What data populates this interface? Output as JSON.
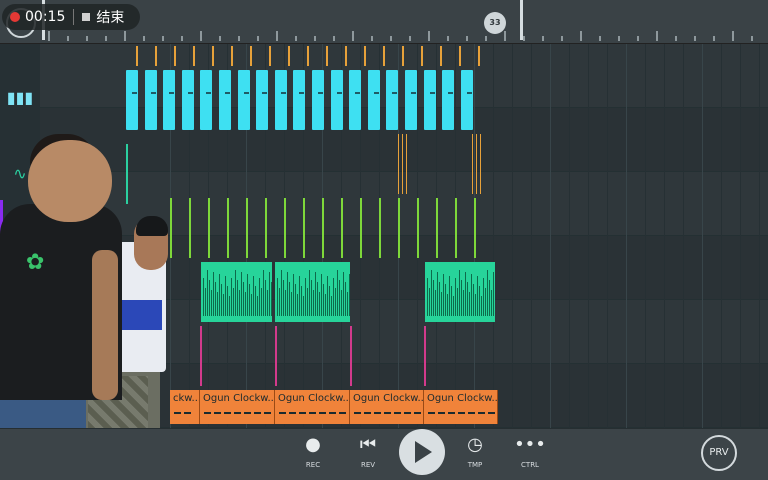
{
  "status": {
    "elapsed": "00:15",
    "stop_label": "结束"
  },
  "timeline": {
    "bar_marker": "33"
  },
  "tracks": {
    "sample_blocks": [
      {
        "title": "ckw..."
      },
      {
        "title": "Ogun Clockw..."
      },
      {
        "title": "Ogun Clockw..."
      },
      {
        "title": "Ogun Clockw..."
      },
      {
        "title": "Ogun Clockw..."
      }
    ]
  },
  "transport": {
    "rec_label": "REC",
    "rev_label": "REV",
    "tmp_label": "TMP",
    "ctrl_label": "CTRL",
    "prv_label": "PRV"
  },
  "colors": {
    "piano": "#3ee0f2",
    "wave": "#27d49a",
    "sample": "#f0833a",
    "accent_orange": "#e7a13a",
    "lime": "#7ed83a",
    "magenta": "#d23a8c"
  }
}
